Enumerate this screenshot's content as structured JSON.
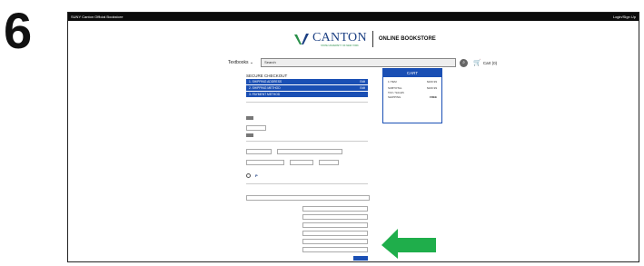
{
  "step_number": "6",
  "topbar": {
    "left": "SUNY Canton Official Bookstore",
    "right": "Login/Sign Up"
  },
  "brand": {
    "name": "CANTON",
    "subtitle": "STATE UNIVERSITY OF NEW YORK",
    "store": "ONLINE BOOKSTORE"
  },
  "nav": {
    "textbooks": "Textbooks",
    "search_placeholder": "Search",
    "cart": "Cart (0)"
  },
  "checkout": {
    "title": "SECURE CHECKOUT",
    "steps": [
      {
        "label": "1. SHIPPING ADDRESS",
        "action": "Edit"
      },
      {
        "label": "2. SHIPPING METHOD",
        "action": "Edit"
      },
      {
        "label": "3. PAYMENT METHOD",
        "action": ""
      }
    ]
  },
  "cart_summary": {
    "title": "CART",
    "rows": [
      {
        "label": "1 ITEM",
        "value": "$160.99"
      },
      {
        "label": "SUBTOTAL",
        "value": "$160.99"
      },
      {
        "label": "TAX / SALES",
        "value": ""
      },
      {
        "label": "SHIPPING",
        "value": "FREE"
      }
    ]
  },
  "colors": {
    "accent": "#1a4fb4",
    "arrow": "#1fae4b"
  }
}
